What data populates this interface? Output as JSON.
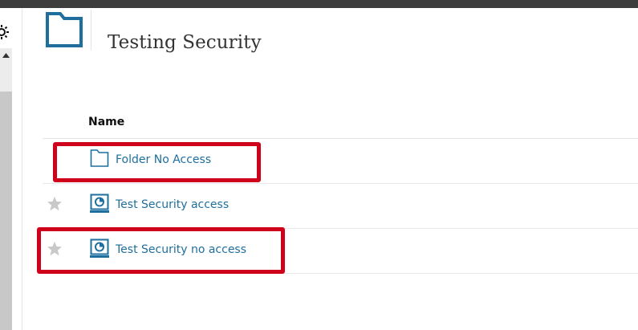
{
  "page": {
    "title": "Testing Security"
  },
  "table": {
    "column_name_header": "Name",
    "rows": [
      {
        "name": "Folder No Access",
        "type": "folder",
        "icon": "folder-icon",
        "favorite": false,
        "highlighted": true
      },
      {
        "name": "Test Security access",
        "type": "report",
        "icon": "dashboard-report-icon",
        "favorite": true,
        "highlighted": false
      },
      {
        "name": "Test Security no access",
        "type": "report",
        "icon": "dashboard-report-icon",
        "favorite": true,
        "highlighted": true
      }
    ]
  },
  "colors": {
    "accent": "#1f6f9e",
    "highlight": "#d0021b",
    "star": "#c9c9c9"
  }
}
